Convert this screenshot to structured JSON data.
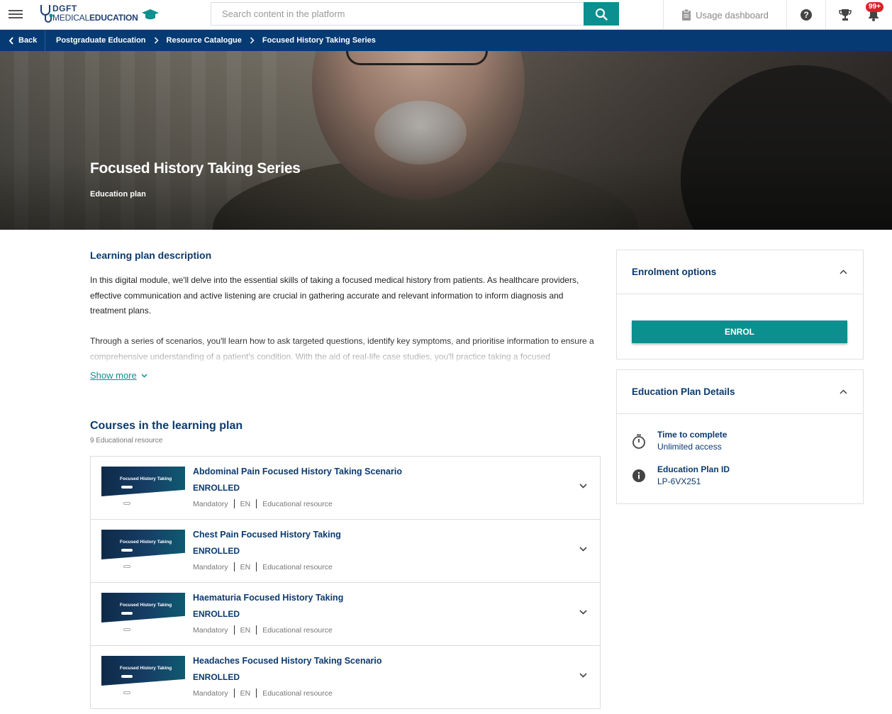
{
  "header": {
    "logo": {
      "line1": "DGFT",
      "line2_a": "MEDICAL",
      "line2_b": "EDUCATION"
    },
    "search": {
      "placeholder": "Search content in the platform",
      "value": ""
    },
    "usage_dashboard": "Usage dashboard",
    "notifications_badge": "99+",
    "icons": [
      "menu-icon",
      "search-icon",
      "clipboard-icon",
      "help-icon",
      "trophy-icon",
      "bell-icon"
    ]
  },
  "breadcrumb": {
    "back": "Back",
    "items": [
      "Postgraduate Education",
      "Resource Catalogue",
      "Focused History Taking Series"
    ]
  },
  "hero": {
    "title": "Focused History Taking Series",
    "subtitle": "Education plan"
  },
  "description": {
    "heading": "Learning plan description",
    "paragraphs": [
      "In this digital module, we'll delve into the essential skills of taking a focused medical history from patients. As healthcare providers, effective communication and active listening are crucial in gathering accurate and relevant information to inform diagnosis and treatment plans.",
      "Through a series of scenarios, you'll learn how to ask targeted questions, identify key symptoms, and prioritise information to ensure a comprehensive understanding of a patient's condition. With the aid of real-life case studies, you'll practice taking a focused"
    ],
    "show_more": "Show more"
  },
  "courses": {
    "heading": "Courses in the learning plan",
    "count": "9 Educational resource",
    "thumbnail_title": "Focused History Taking",
    "items": [
      {
        "title": "Abdominal Pain Focused History Taking Scenario",
        "status": "ENROLLED",
        "meta": [
          "Mandatory",
          "EN",
          "Educational resource"
        ]
      },
      {
        "title": "Chest Pain Focused History Taking",
        "status": "ENROLLED",
        "meta": [
          "Mandatory",
          "EN",
          "Educational resource"
        ]
      },
      {
        "title": "Haematuria Focused History Taking",
        "status": "ENROLLED",
        "meta": [
          "Mandatory",
          "EN",
          "Educational resource"
        ]
      },
      {
        "title": "Headaches Focused History Taking Scenario",
        "status": "ENROLLED",
        "meta": [
          "Mandatory",
          "EN",
          "Educational resource"
        ]
      }
    ]
  },
  "sidebar": {
    "enrolment": {
      "title": "Enrolment options",
      "button": "ENROL"
    },
    "details": {
      "title": "Education Plan Details",
      "rows": [
        {
          "label": "Time to complete",
          "value": "Unlimited access",
          "icon": "timer-icon"
        },
        {
          "label": "Education Plan ID",
          "value": "LP-6VX251",
          "icon": "info-icon"
        }
      ]
    }
  },
  "colors": {
    "navy": "#063a73",
    "heading": "#0b3a6e",
    "teal": "#0c8f8f",
    "badge": "#d8232a"
  }
}
